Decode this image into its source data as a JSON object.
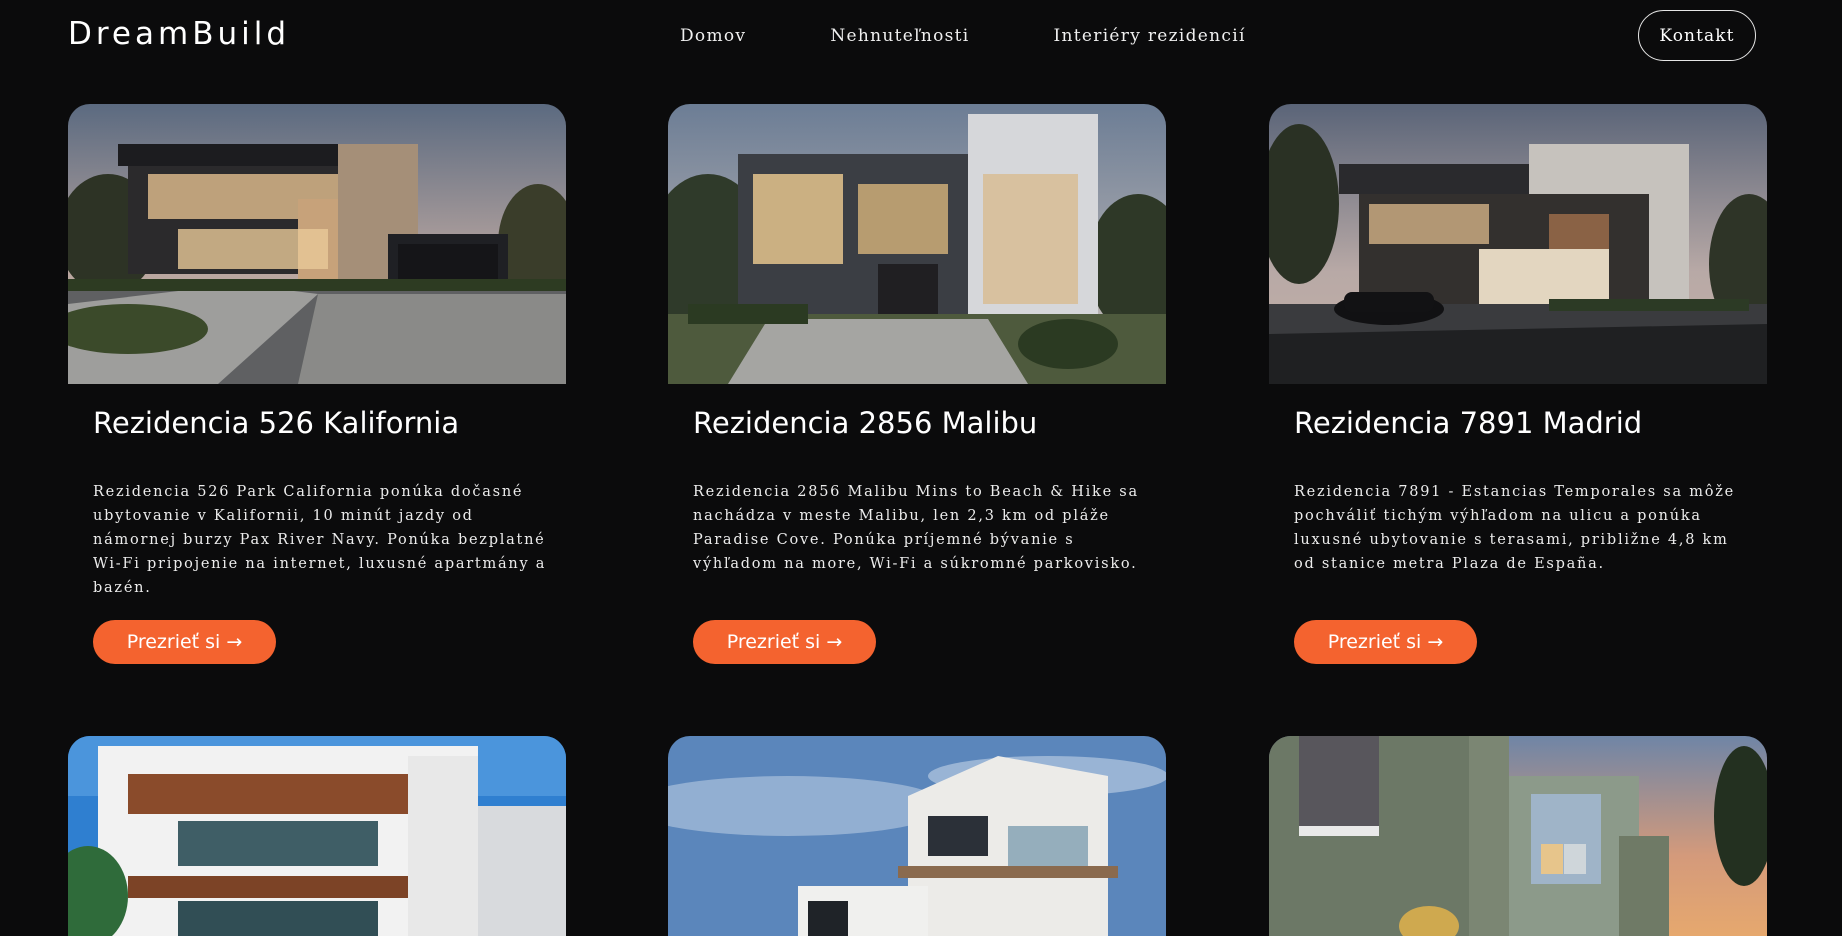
{
  "brand": {
    "logo": "DreamBuild"
  },
  "nav": {
    "links": [
      "Domov",
      "Nehnuteľnosti",
      "Interiéry rezidencií"
    ],
    "contact_label": "Kontakt"
  },
  "colors": {
    "background": "#0b0b0c",
    "accent": "#f4632f",
    "text": "#ffffff"
  },
  "cards": [
    {
      "title": "Rezidencia 526 Kalifornia",
      "description": "Rezidencia 526 Park California ponúka dočasné ubytovanie v Kalifornii, 10 minút jazdy od námornej burzy Pax River Navy. Ponúka bezplatné Wi-Fi pripojenie na internet, luxusné apartmány a bazén.",
      "button": "Prezrieť si →",
      "image": "modern-villa-dusk"
    },
    {
      "title": "Rezidencia 2856 Malibu",
      "description": "Rezidencia 2856 Malibu Mins to Beach & Hike sa nachádza v meste Malibu, len 2,3 km od pláže Paradise Cove. Ponúka príjemné bývanie s výhľadom na more, Wi-Fi a súkromné parkovisko.",
      "button": "Prezrieť si →",
      "image": "modern-house-glass-front"
    },
    {
      "title": "Rezidencia 7891 Madrid",
      "description": "Rezidencia 7891 - Estancias Temporales sa môže pochváliť tichým výhľadom na ulicu a ponúka luxusné ubytovanie s terasami, približne 4,8 km od stanice metra Plaza de España.",
      "button": "Prezrieť si →",
      "image": "modern-house-with-car"
    },
    {
      "image": "white-villa-wood-ceiling"
    },
    {
      "image": "white-modern-building-sky"
    },
    {
      "image": "green-facade-sunset"
    }
  ]
}
